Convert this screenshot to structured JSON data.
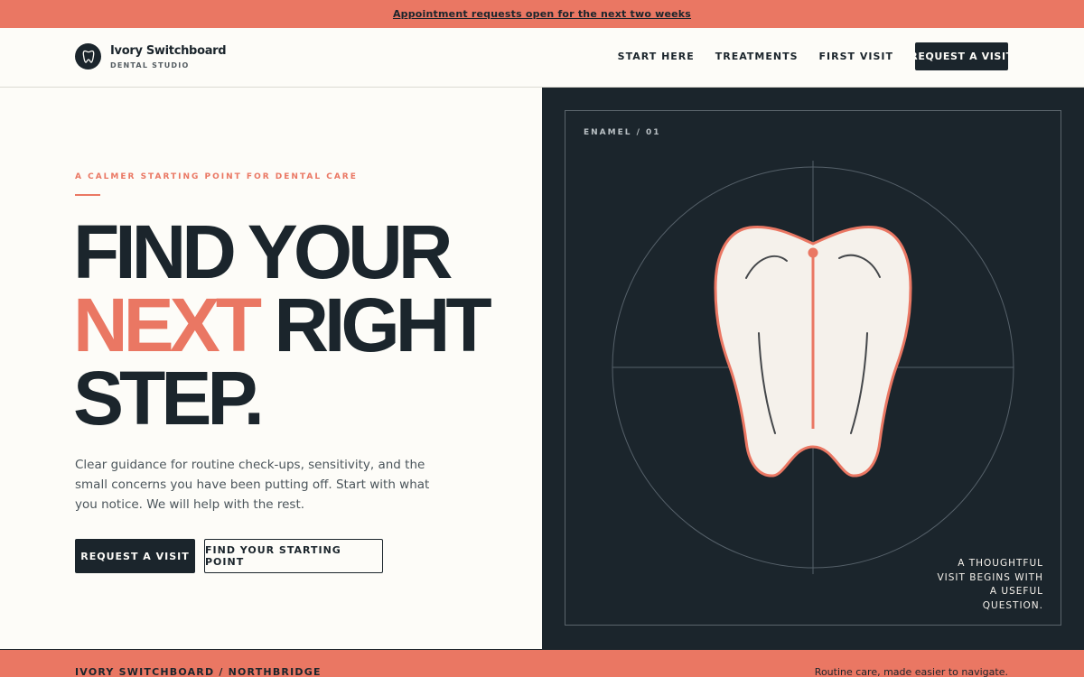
{
  "announcement": {
    "text": "Appointment requests open for the next two weeks"
  },
  "brand": {
    "name": "Ivory Switchboard",
    "subtitle": "DENTAL STUDIO",
    "logo_icon": "tooth-icon"
  },
  "nav": {
    "items": [
      {
        "label": "START HERE"
      },
      {
        "label": "TREATMENTS"
      },
      {
        "label": "FIRST VISIT"
      }
    ],
    "cta_label": "REQUEST A VISIT"
  },
  "hero": {
    "eyebrow": "A CALMER STARTING POINT FOR DENTAL CARE",
    "headline": {
      "line1": "FIND YOUR",
      "line2_accent": "NEXT",
      "line2_rest": " RIGHT",
      "line3": "STEP."
    },
    "lede": "Clear guidance for routine check-ups, sensitivity, and the small concerns you have been putting off. Start with what you notice. We will help with the rest.",
    "primary_button": "REQUEST A VISIT",
    "secondary_button": "FIND YOUR STARTING POINT"
  },
  "illustration": {
    "label": "ENAMEL / 01",
    "caption_lines": [
      "A THOUGHTFUL",
      "VISIT BEGINS WITH",
      "A USEFUL",
      "QUESTION."
    ]
  },
  "footer": {
    "left": "IVORY SWITCHBOARD / NORTHBRIDGE",
    "right": "Routine care, made easier to navigate."
  },
  "colors": {
    "accent": "#ea7763",
    "ink": "#1b252c",
    "paper": "#fdfcf8",
    "tooth_fill": "#f5f1eb"
  }
}
